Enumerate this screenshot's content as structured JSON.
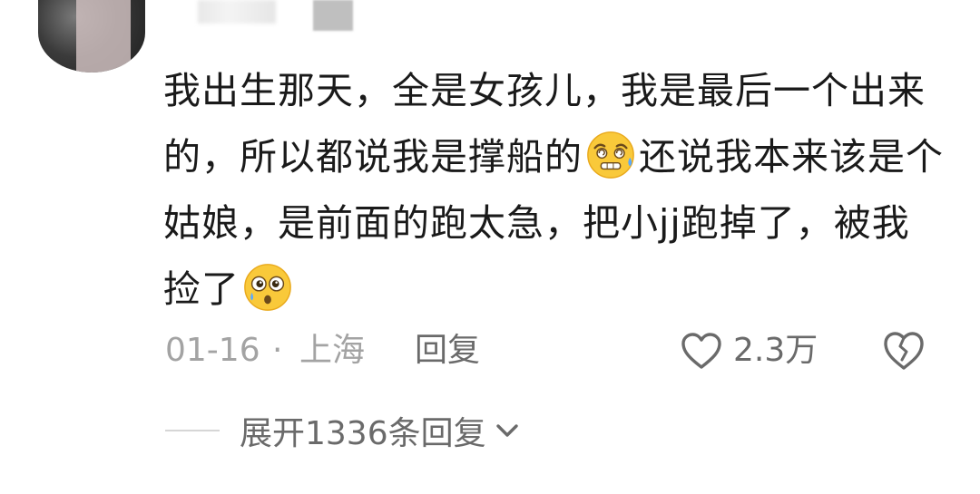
{
  "comment": {
    "text_part1": "我出生那天，全是女孩儿，我是最后一个出来的，所以都说我是撑船的",
    "emoji1": "sweat-dizzy-emoji",
    "text_part2": "还说我本来该是个姑娘，是前面的跑太急，把小jj跑掉了，被我捡了",
    "emoji2": "shocked-crying-emoji"
  },
  "meta": {
    "date": "01-16",
    "separator": "·",
    "location": "上海",
    "reply_label": "回复",
    "like_count": "2.3万"
  },
  "replies": {
    "expand_label": "展开1336条回复"
  },
  "colors": {
    "text": "#1a1a1a",
    "meta_gray": "#a3a3a3",
    "action_gray": "#6a6a6a",
    "emoji_yellow": "#f9c93a"
  }
}
